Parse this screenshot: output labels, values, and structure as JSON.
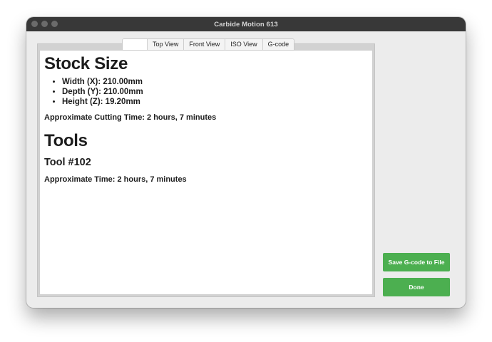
{
  "window": {
    "title": "Carbide Motion 613"
  },
  "tabs": [
    {
      "label": ""
    },
    {
      "label": "Top View"
    },
    {
      "label": "Front View"
    },
    {
      "label": "ISO View"
    },
    {
      "label": "G-code"
    }
  ],
  "content": {
    "stock_heading": "Stock Size",
    "dimensions": [
      "Width (X): 210.00mm",
      "Depth (Y): 210.00mm",
      "Height (Z): 19.20mm"
    ],
    "approx_cutting_time": "Approximate Cutting Time: 2 hours, 7 minutes",
    "tools_heading": "Tools",
    "tool_name": "Tool #102",
    "tool_approx_time": "Approximate Time: 2 hours, 7 minutes"
  },
  "buttons": {
    "save_label": "Save G-code to File",
    "done_label": "Done"
  },
  "colors": {
    "button_green": "#4caf50",
    "titlebar": "#383838"
  }
}
